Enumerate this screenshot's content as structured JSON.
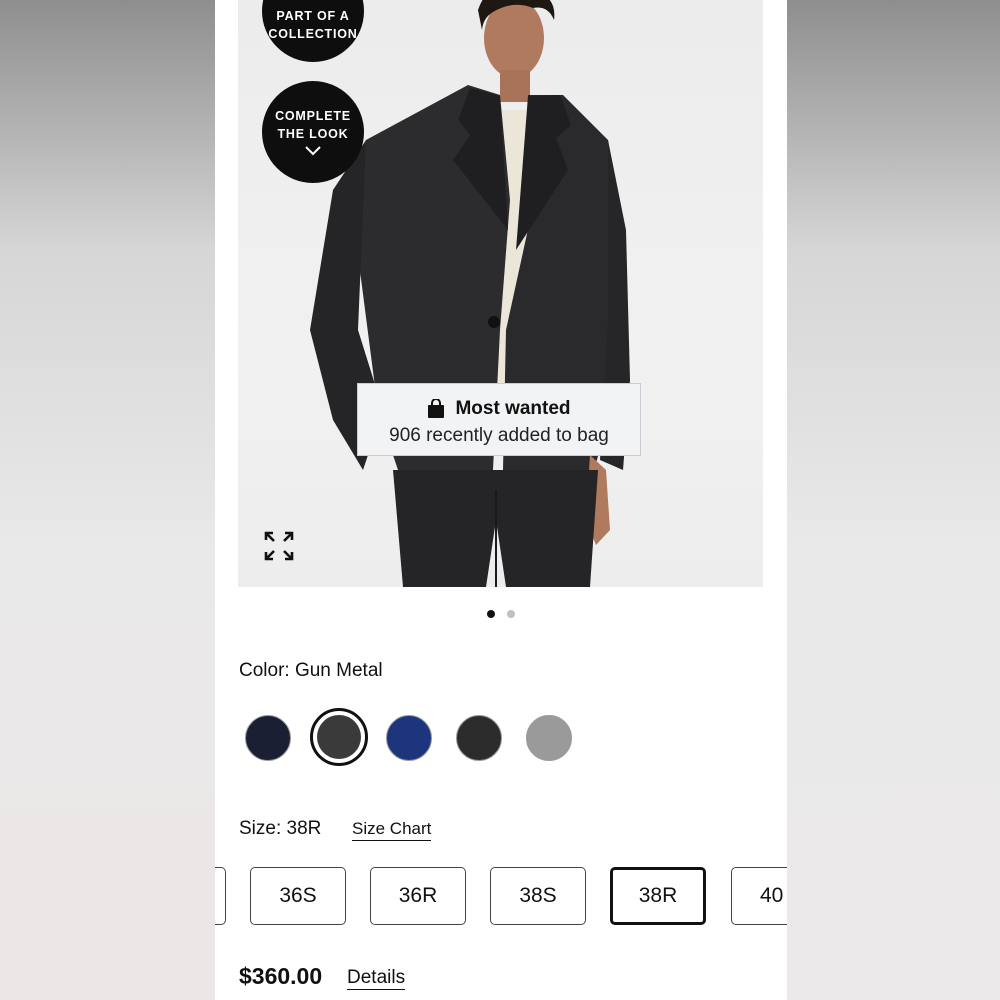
{
  "badges": {
    "collection_label": "PART OF A COLLECTION",
    "complete_look_label": "COMPLETE THE LOOK"
  },
  "tooltip": {
    "title": "Most wanted",
    "subtitle": "906 recently added to bag"
  },
  "carousel": {
    "total": 2,
    "active_index": 0
  },
  "color": {
    "label": "Color: Gun Metal",
    "swatches": [
      {
        "name": "navy",
        "hex": "#1b1f33",
        "selected": false
      },
      {
        "name": "gun-metal",
        "hex": "#3a3a3b",
        "selected": true
      },
      {
        "name": "blue",
        "hex": "#1c357d",
        "selected": false
      },
      {
        "name": "charcoal",
        "hex": "#2c2c2c",
        "selected": false
      },
      {
        "name": "grey",
        "hex": "#9a9a9a",
        "selected": false
      }
    ]
  },
  "size": {
    "label": "Size: 38R",
    "chart_link": "Size Chart",
    "options": [
      "",
      "36S",
      "36R",
      "38S",
      "38R",
      "40"
    ],
    "selected": "38R"
  },
  "price": {
    "value": "$360.00",
    "details_link": "Details"
  },
  "icons": {
    "expand": "expand-icon",
    "bag": "shopping-bag-icon",
    "chevron": "chevron-down-icon"
  }
}
